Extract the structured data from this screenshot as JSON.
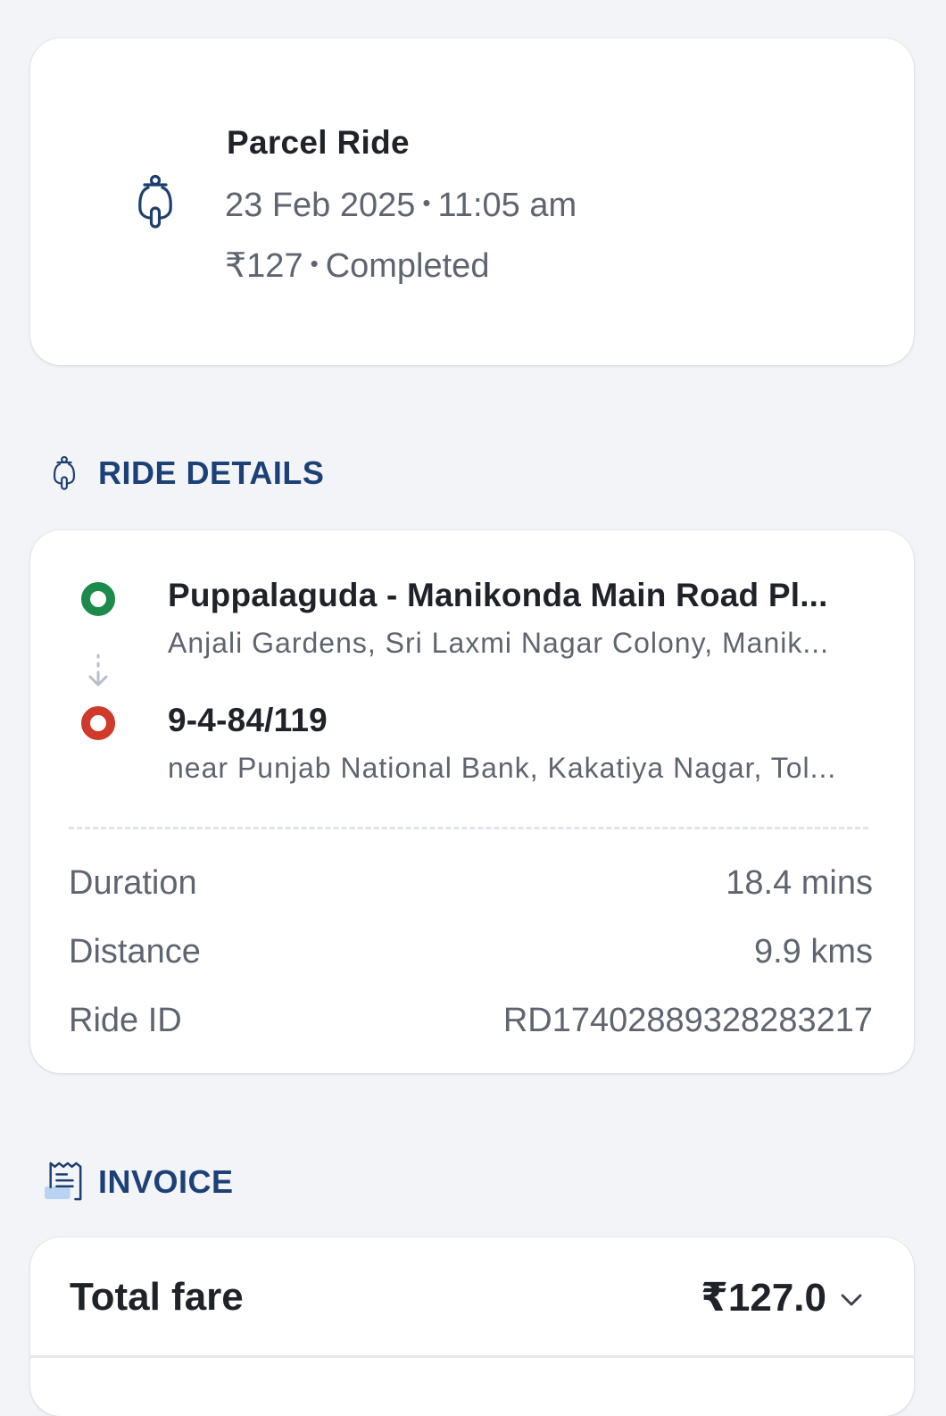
{
  "summary": {
    "title": "Parcel Ride",
    "date": "23 Feb 2025",
    "time": "11:05 am",
    "price": "₹127",
    "status": "Completed",
    "icon": "scooter-icon"
  },
  "ride_details": {
    "header": "RIDE DETAILS",
    "header_icon": "scooter-icon",
    "pickup": {
      "title": "Puppalaguda - Manikonda Main Road Pl...",
      "subtitle": "Anjali Gardens, Sri Laxmi Nagar Colony, Manik...",
      "color": "#1c8a4a"
    },
    "drop": {
      "title": "9-4-84/119",
      "subtitle": "near Punjab National Bank, Kakatiya Nagar, Tol...",
      "color": "#cf3a2a"
    },
    "stats": {
      "duration_label": "Duration",
      "duration_value": "18.4 mins",
      "distance_label": "Distance",
      "distance_value": "9.9 kms",
      "ride_id_label": "Ride ID",
      "ride_id_value": "RD17402889328283217"
    }
  },
  "invoice": {
    "header": "INVOICE",
    "header_icon": "receipt-icon",
    "total_fare_label": "Total fare",
    "total_fare_value": "₹127.0",
    "expand_icon": "chevron-down-icon"
  },
  "colors": {
    "background": "#f3f4f8",
    "section_header": "#1c4177",
    "pickup": "#1c8a4a",
    "drop": "#cf3a2a"
  }
}
